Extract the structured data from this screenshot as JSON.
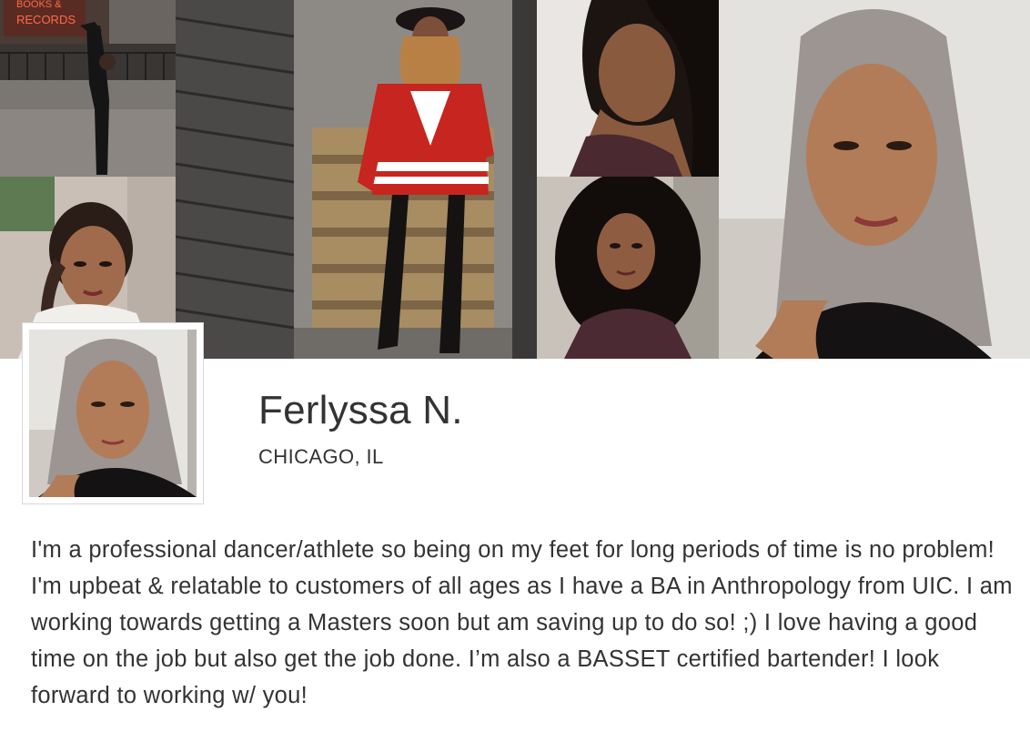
{
  "profile": {
    "name": "Ferlyssa N.",
    "location": "CHICAGO, IL",
    "bio": "I'm a professional dancer/athlete so being on my feet for long periods of time is no problem! I'm upbeat & relatable to customers of all ages as I have a BA in Anthropology from UIC. I am working towards getting a Masters soon but am saving up to do so! ;) I love having a good time on the job but also get the job done. I’m also a BASSET certified bartender! I look forward to working w/ you!"
  },
  "cover": {
    "storefront_sign": "BOOKS & RECORDS"
  },
  "colors": {
    "text": "#333333",
    "background": "#ffffff",
    "avatar_border": "#d8d8d8"
  }
}
